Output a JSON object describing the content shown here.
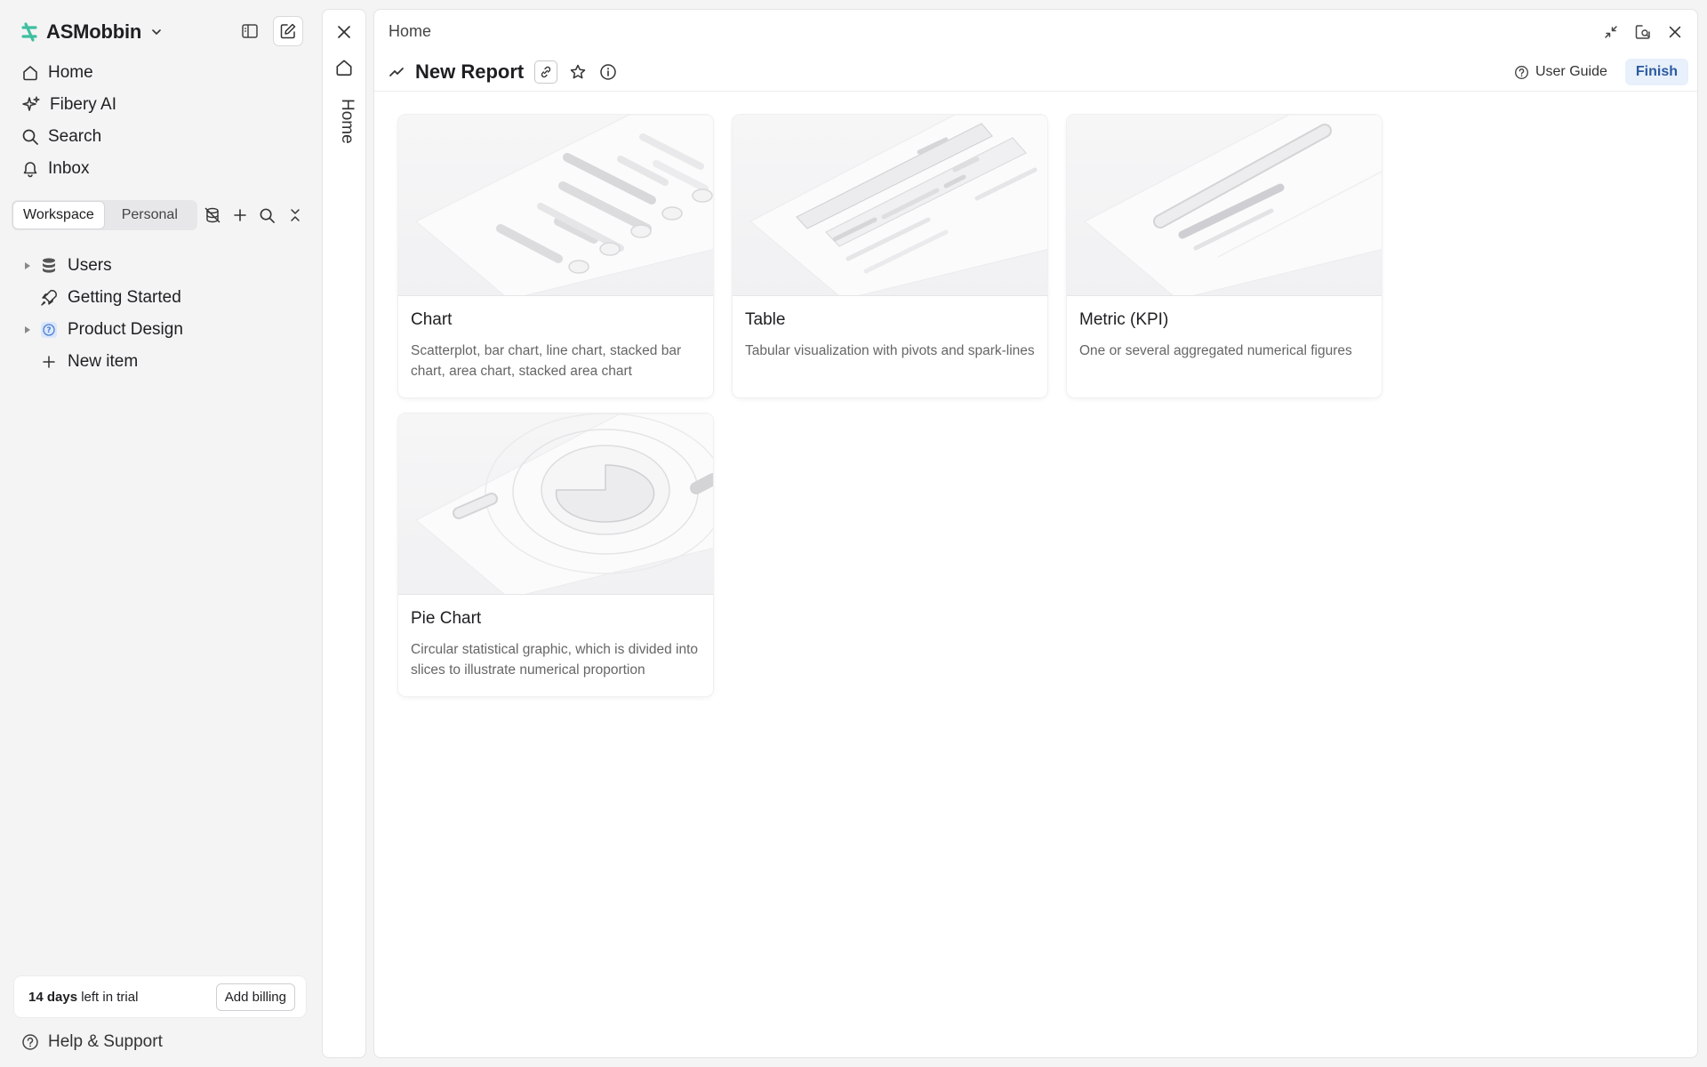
{
  "workspace": {
    "name": "ASMobbin",
    "logo_color": "#3fbf9f"
  },
  "nav": [
    {
      "label": "Home",
      "icon": "home-icon"
    },
    {
      "label": "Fibery AI",
      "icon": "sparkle-icon"
    },
    {
      "label": "Search",
      "icon": "search-icon"
    },
    {
      "label": "Inbox",
      "icon": "bell-icon"
    }
  ],
  "tabs": {
    "workspace": "Workspace",
    "personal": "Personal",
    "active": "Workspace"
  },
  "tree": [
    {
      "label": "Users",
      "icon": "database-icon",
      "expandable": true
    },
    {
      "label": "Getting Started",
      "icon": "rocket-icon",
      "expandable": false
    },
    {
      "label": "Product Design",
      "icon": "question-icon",
      "expandable": true
    },
    {
      "label": "New item",
      "icon": "plus-icon",
      "expandable": false
    }
  ],
  "trial": {
    "days": "14 days",
    "text": " left in trial",
    "button": "Add billing"
  },
  "help": "Help & Support",
  "collapsed_panel": {
    "label": "Home"
  },
  "main": {
    "breadcrumb": "Home",
    "title": "New Report",
    "user_guide": "User Guide",
    "finish": "Finish",
    "accent": "#2c5aa0"
  },
  "cards": [
    {
      "title": "Chart",
      "description": "Scatterplot, bar chart, line chart, stacked bar chart, area chart, stacked area chart"
    },
    {
      "title": "Table",
      "description": "Tabular visualization with pivots and spark-lines"
    },
    {
      "title": "Metric (KPI)",
      "description": "One or several aggregated numerical figures"
    },
    {
      "title": "Pie Chart",
      "description": "Circular statistical graphic, which is divided into slices to illustrate numerical proportion"
    }
  ]
}
